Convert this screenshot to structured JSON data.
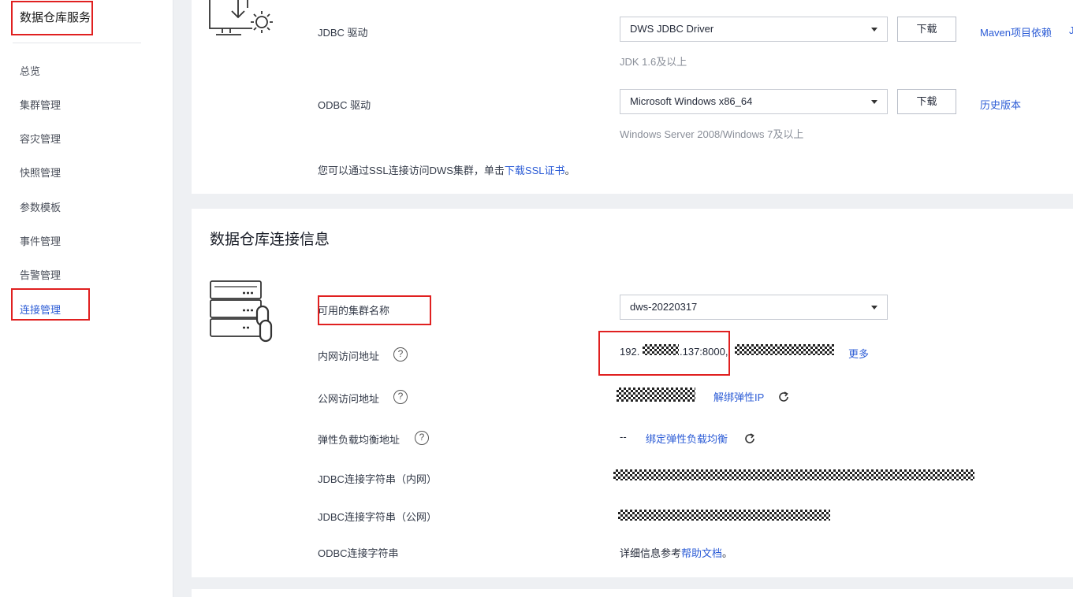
{
  "sidebar": {
    "title": "数据仓库服务",
    "items": [
      {
        "label": "总览"
      },
      {
        "label": "集群管理"
      },
      {
        "label": "容灾管理"
      },
      {
        "label": "快照管理"
      },
      {
        "label": "参数模板"
      },
      {
        "label": "事件管理"
      },
      {
        "label": "告警管理"
      },
      {
        "label": "连接管理",
        "active": true
      }
    ]
  },
  "drivers": {
    "jdbc": {
      "label": "JDBC 驱动",
      "selected": "DWS JDBC Driver",
      "download": "下载",
      "note": "JDK 1.6及以上",
      "link": "Maven项目依赖",
      "link_cut": "J"
    },
    "odbc": {
      "label": "ODBC 驱动",
      "selected": "Microsoft Windows x86_64",
      "download": "下载",
      "note": "Windows Server 2008/Windows 7及以上",
      "link": "历史版本"
    },
    "ssl_text": "您可以通过SSL连接访问DWS集群，单击",
    "ssl_link": "下载SSL证书",
    "ssl_end": "。"
  },
  "connection": {
    "title": "数据仓库连接信息",
    "cluster": {
      "label": "可用的集群名称",
      "selected": "dws-20220317"
    },
    "private": {
      "label": "内网访问地址",
      "prefix": "192.",
      "suffix": ".137:8000,",
      "more": "更多"
    },
    "public": {
      "label": "公网访问地址",
      "unbind": "解绑弹性IP"
    },
    "elb": {
      "label": "弹性负载均衡地址",
      "value": "--",
      "bind": "绑定弹性负载均衡"
    },
    "jdbc_private": {
      "label": "JDBC连接字符串（内网）"
    },
    "jdbc_public": {
      "label": "JDBC连接字符串（公网）"
    },
    "odbc": {
      "label": "ODBC连接字符串",
      "text": "详细信息参考",
      "link": "帮助文档",
      "end": "。"
    }
  },
  "icons": {
    "download": "download-monitor-gear-icon",
    "server": "server-link-icon",
    "help": "help-icon",
    "refresh": "refresh-icon"
  },
  "colors": {
    "link": "#2c5cd6",
    "highlight": "#e02020",
    "page_bg": "#eef0f3"
  }
}
